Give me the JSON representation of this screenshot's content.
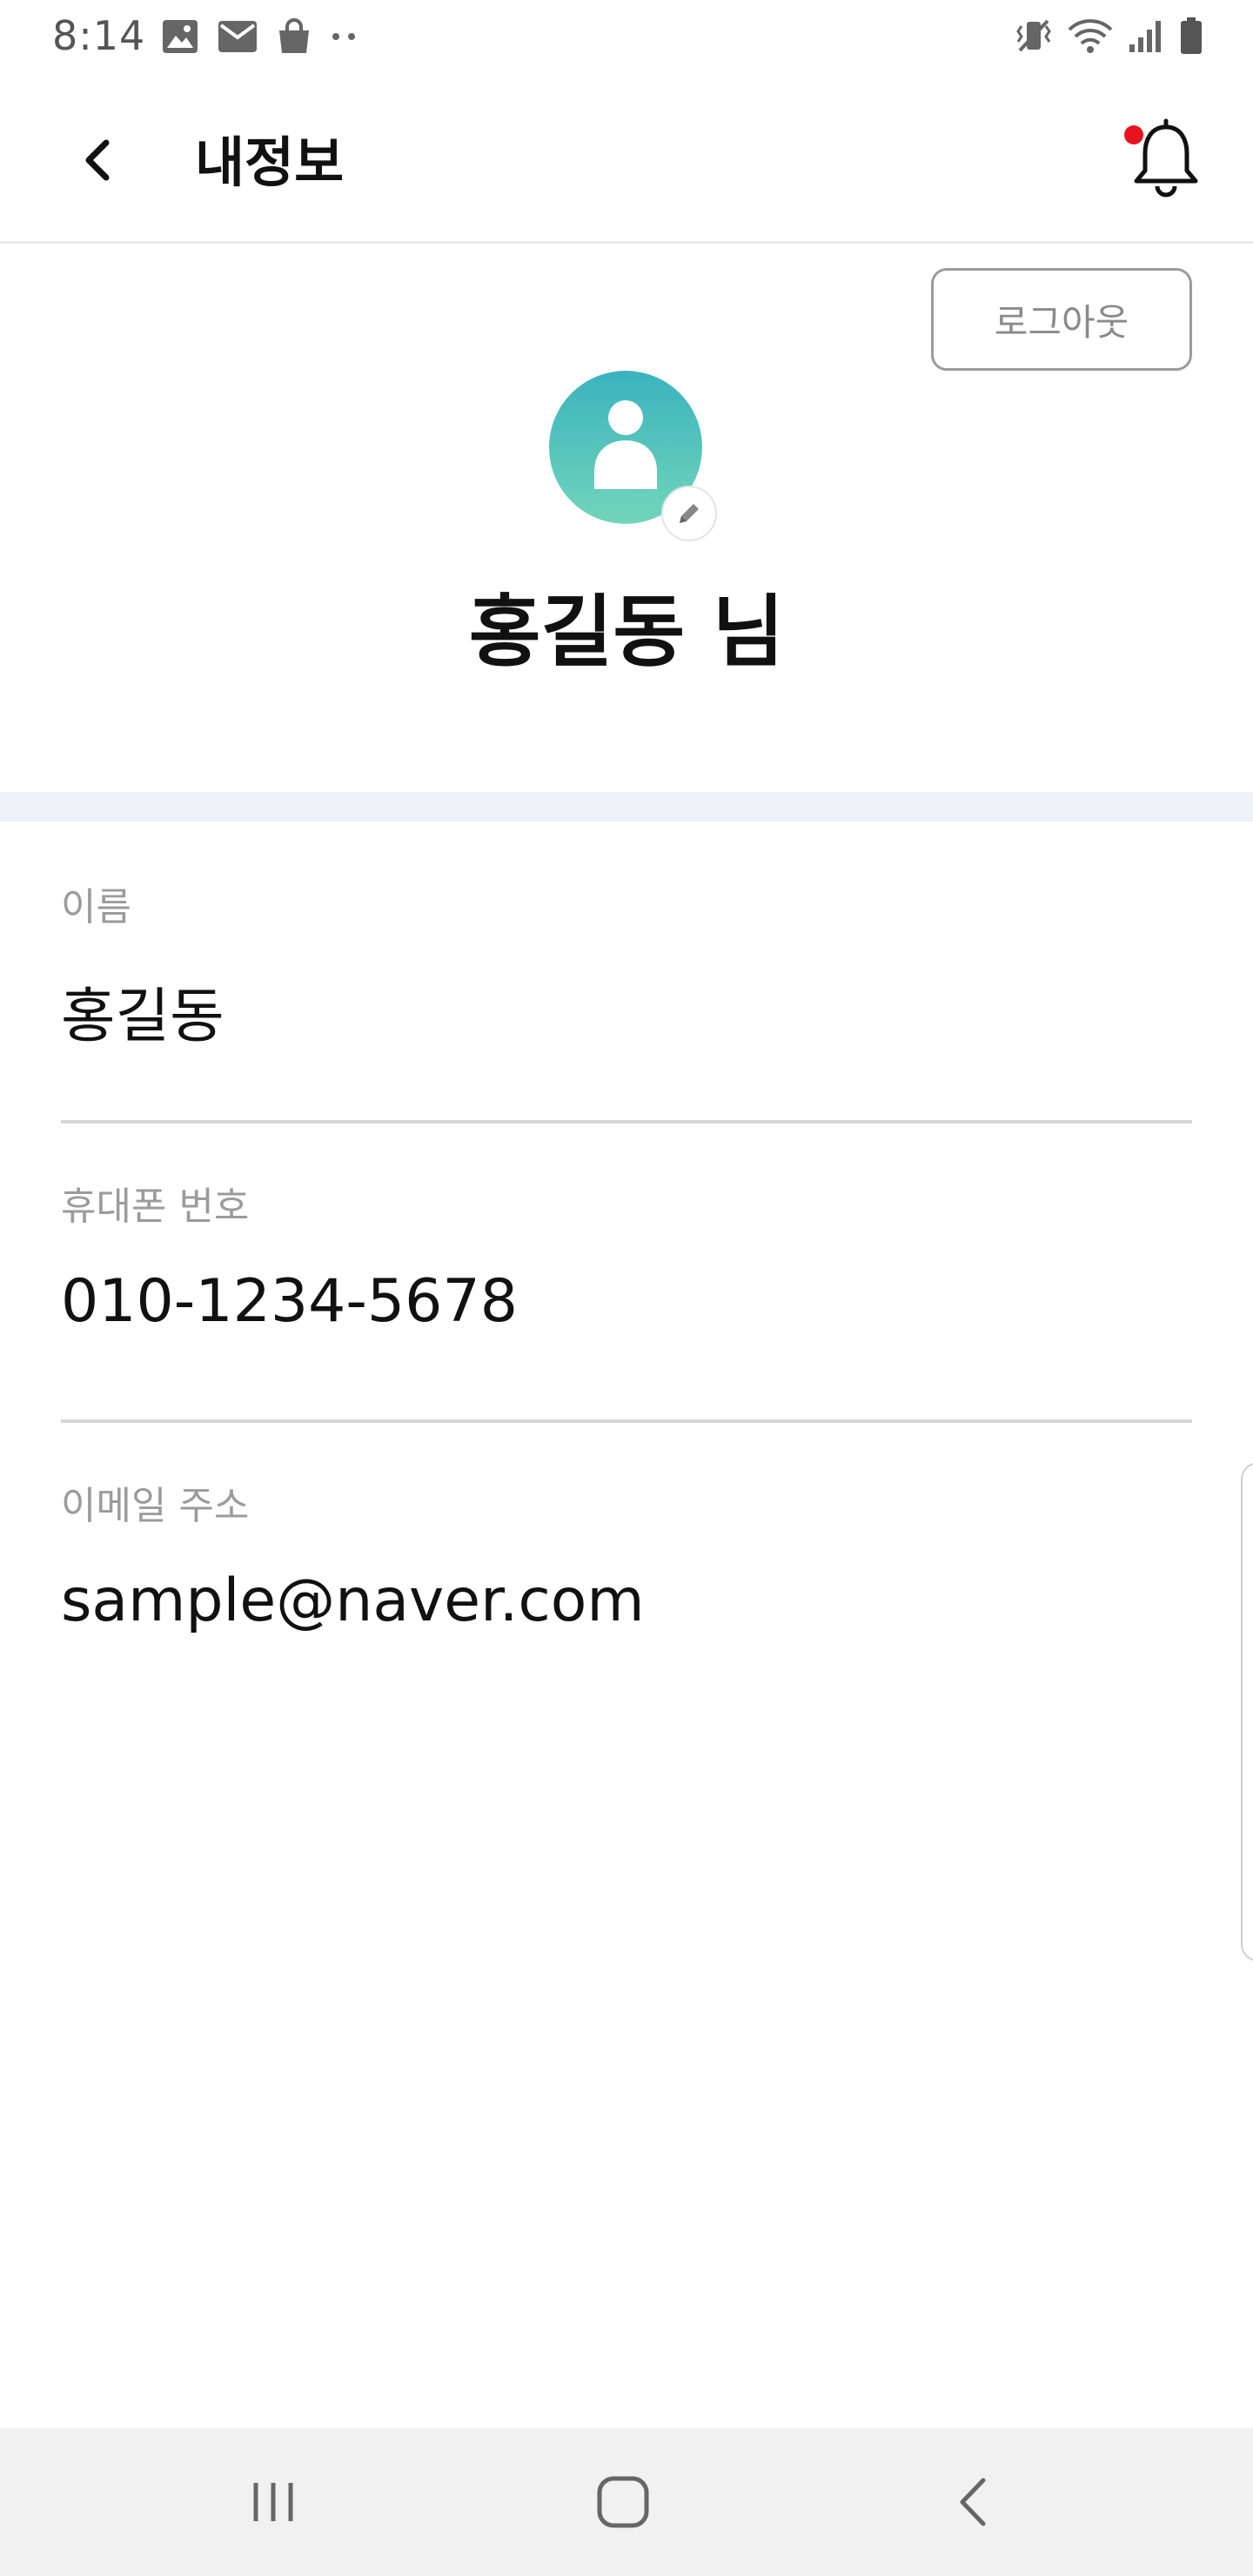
{
  "status_bar": {
    "time": "8:14",
    "left_icons": [
      "gallery-icon",
      "mail-icon",
      "shopping-bag-icon",
      "more-dots-icon"
    ],
    "right_icons": [
      "vibrate-mute-icon",
      "wifi-icon",
      "signal-icon",
      "battery-icon"
    ]
  },
  "app_bar": {
    "title": "내정보",
    "back_icon": "chevron-left-icon",
    "notification_icon": "bell-icon",
    "notification_dot_color": "#e8131f"
  },
  "profile": {
    "logout_label": "로그아웃",
    "name": "홍길동 님",
    "avatar_gradient": [
      "#3ab3bd",
      "#72d5bb"
    ],
    "edit_icon": "pencil-icon"
  },
  "fields": [
    {
      "label": "이름",
      "value": "홍길동"
    },
    {
      "label": "휴대폰 번호",
      "value": "010-1234-5678"
    },
    {
      "label": "이메일 주소",
      "value": "sample@naver.com"
    }
  ],
  "nav_bar": {
    "buttons": [
      "recent-apps-icon",
      "home-icon",
      "back-icon"
    ]
  }
}
